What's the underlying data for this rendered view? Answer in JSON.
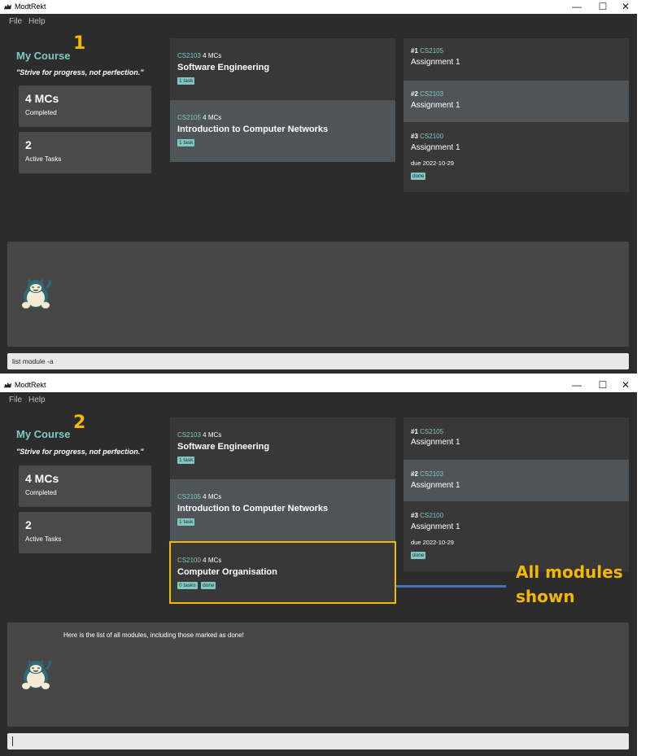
{
  "app": {
    "title": "ModtRekt",
    "minimize": "—",
    "maximize": "☐",
    "close": "✕"
  },
  "menu": {
    "file": "File",
    "help": "Help"
  },
  "colors": {
    "accent": "#7fc9c4",
    "annotation": "#f5b800",
    "connector": "#4a72c4"
  },
  "screens": [
    {
      "step": "1",
      "course_title": "My Course",
      "quote": "\"Strive for progress, not perfection.\"",
      "stats": [
        {
          "value": "4 MCs",
          "label": "Completed"
        },
        {
          "value": "2",
          "label": "Active Tasks"
        }
      ],
      "modules": [
        {
          "code": "CS2103",
          "credits": "4 MCs",
          "name": "Software Engineering",
          "tags": [
            "1 task"
          ]
        },
        {
          "code": "CS2105",
          "credits": "4 MCs",
          "name": "Introduction to Computer Networks",
          "tags": [
            "1 task"
          ]
        }
      ],
      "tasks": [
        {
          "num": "#1",
          "code": "CS2105",
          "name": "Assignment 1",
          "due": "",
          "tags": []
        },
        {
          "num": "#2",
          "code": "CS2103",
          "name": "Assignment 1",
          "due": "",
          "tags": []
        },
        {
          "num": "#3",
          "code": "CS2100",
          "name": "Assignment 1",
          "due": "due 2022-10-29",
          "tags": [
            "done"
          ]
        }
      ],
      "result_text": "",
      "command_value": "list module -a",
      "mascot_icon": "snorlax-icon"
    },
    {
      "step": "2",
      "course_title": "My Course",
      "quote": "\"Strive for progress, not perfection.\"",
      "stats": [
        {
          "value": "4 MCs",
          "label": "Completed"
        },
        {
          "value": "2",
          "label": "Active Tasks"
        }
      ],
      "modules": [
        {
          "code": "CS2103",
          "credits": "4 MCs",
          "name": "Software Engineering",
          "tags": [
            "1 task"
          ]
        },
        {
          "code": "CS2105",
          "credits": "4 MCs",
          "name": "Introduction to Computer Networks",
          "tags": [
            "1 task"
          ]
        },
        {
          "code": "CS2100",
          "credits": "4 MCs",
          "name": "Computer Organisation",
          "tags": [
            "0 tasks",
            "done"
          ]
        }
      ],
      "tasks": [
        {
          "num": "#1",
          "code": "CS2105",
          "name": "Assignment 1",
          "due": "",
          "tags": []
        },
        {
          "num": "#2",
          "code": "CS2103",
          "name": "Assignment 1",
          "due": "",
          "tags": []
        },
        {
          "num": "#3",
          "code": "CS2100",
          "name": "Assignment 1",
          "due": "due 2022-10-29",
          "tags": [
            "done"
          ]
        }
      ],
      "result_text": "Here is the list of all modules, including those marked as done!",
      "command_value": "",
      "mascot_icon": "snorlax-icon"
    }
  ],
  "annotation": {
    "line1": "All modules",
    "line2": "shown"
  }
}
